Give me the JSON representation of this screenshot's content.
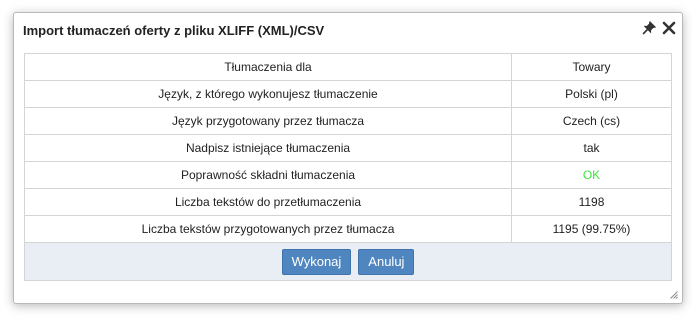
{
  "dialog": {
    "title": "Import tłumaczeń oferty z pliku XLIFF (XML)/CSV",
    "icons": {
      "pin": "pin-icon",
      "close": "close-icon",
      "resize": "resize-grip-icon"
    }
  },
  "table": {
    "rows": [
      {
        "label": "Tłumaczenia dla",
        "value": "Towary"
      },
      {
        "label": "Język, z którego wykonujesz tłumaczenie",
        "value": "Polski (pl)"
      },
      {
        "label": "Język przygotowany przez tłumacza",
        "value": "Czech (cs)"
      },
      {
        "label": "Nadpisz istniejące tłumaczenia",
        "value": "tak"
      },
      {
        "label": "Poprawność składni tłumaczenia",
        "value": "OK"
      },
      {
        "label": "Liczba tekstów do przetłumaczenia",
        "value": "1198"
      },
      {
        "label": "Liczba tekstów przygotowanych przez tłumacza",
        "value": "1195 (99.75%)"
      }
    ]
  },
  "buttons": {
    "execute": "Wykonaj",
    "cancel": "Anuluj"
  },
  "colors": {
    "ok_status": "#3fe43f",
    "button_bg": "#4f86c0",
    "footer_bg": "#e9eef5"
  }
}
